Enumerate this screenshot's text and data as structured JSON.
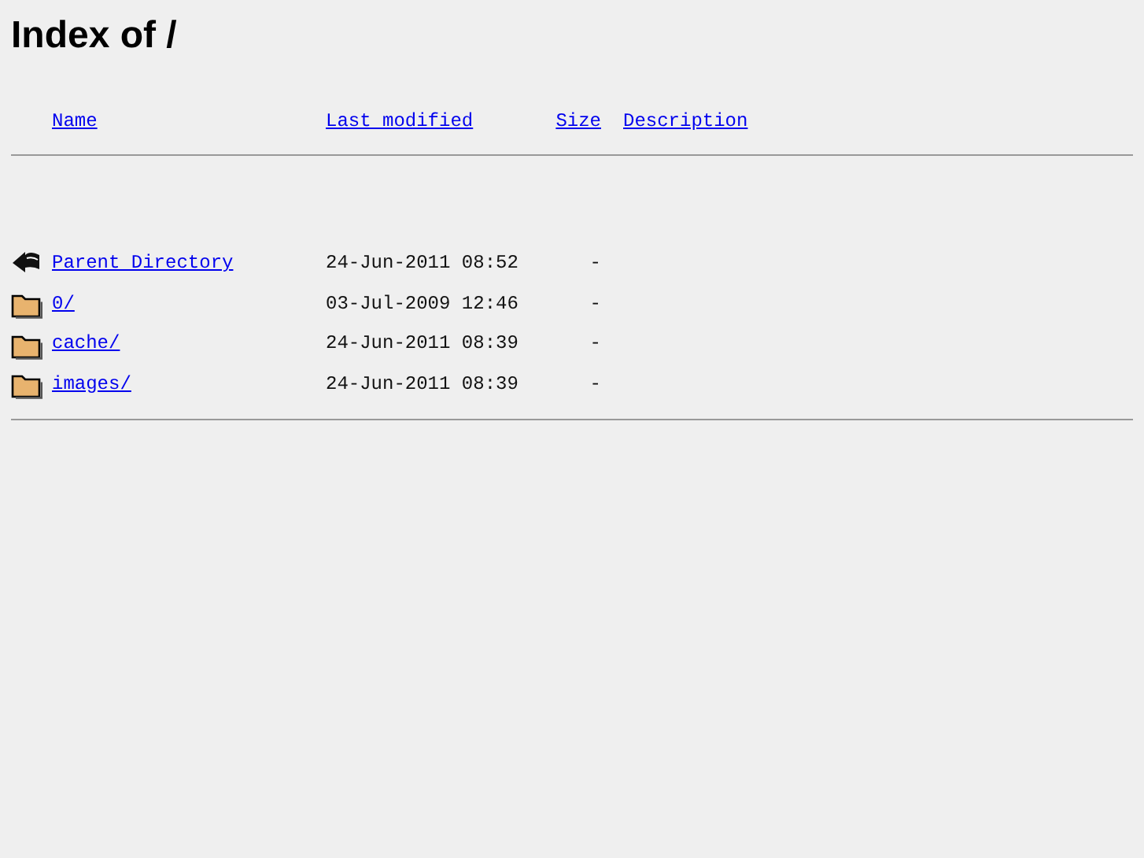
{
  "title": "Index of /",
  "columns": [
    "Name",
    "Last modified",
    "Size",
    "Description"
  ],
  "rows": [
    {
      "kind": "parent",
      "name": "Parent Directory",
      "modified": "24-Jun-2011 08:52",
      "size": "-"
    },
    {
      "kind": "folder",
      "name": "0/",
      "modified": "03-Jul-2009 12:46",
      "size": "-"
    },
    {
      "kind": "folder",
      "name": "cache/",
      "modified": "24-Jun-2011 08:39",
      "size": "-"
    },
    {
      "kind": "folder",
      "name": "images/",
      "modified": "24-Jun-2011 08:39",
      "size": "-"
    }
  ]
}
